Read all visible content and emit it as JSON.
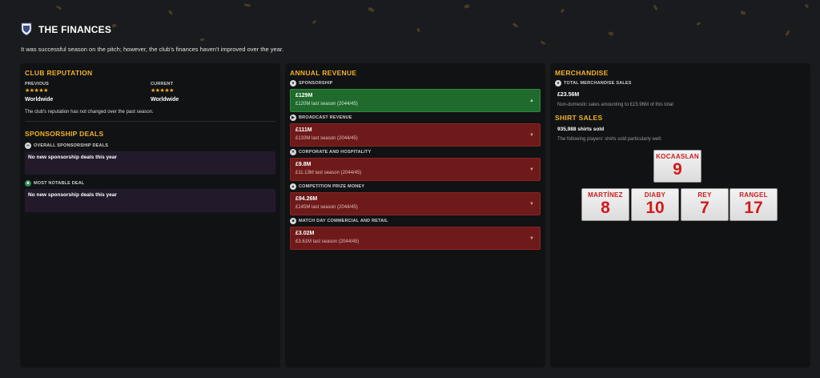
{
  "header": {
    "title": "THE FINANCES",
    "intro": "It was successful season on the pitch; however, the club's finances haven't improved over the year."
  },
  "reputation": {
    "title": "CLUB REPUTATION",
    "previous_label": "PREVIOUS",
    "previous_stars": "★★★★★",
    "previous_value": "Worldwide",
    "current_label": "CURRENT",
    "current_stars": "★★★★★",
    "current_value": "Worldwide",
    "note": "The club's reputation has not changed over the past season."
  },
  "sponsorship": {
    "title": "SPONSORSHIP DEALS",
    "overall_label": "OVERALL SPONSORSHIP DEALS",
    "overall_text": "No new sponsorship deals this year",
    "notable_label": "MOST NOTABLE DEAL",
    "notable_text": "No new sponsorship deals this year"
  },
  "revenue": {
    "title": "ANNUAL REVENUE",
    "items": [
      {
        "label": "SPONSORSHIP",
        "value": "£129M",
        "previous": "£120M last season (2044/45)",
        "trend": "up",
        "arrow": "▲"
      },
      {
        "label": "BROADCAST REVENUE",
        "value": "£111M",
        "previous": "£133M last season (2044/45)",
        "trend": "down",
        "arrow": "▼"
      },
      {
        "label": "CORPORATE AND HOSPITALITY",
        "value": "£9.8M",
        "previous": "£11.13M last season (2044/45)",
        "trend": "down",
        "arrow": "▼"
      },
      {
        "label": "COMPETITION PRIZE MONEY",
        "value": "£94.26M",
        "previous": "£145M last season (2044/45)",
        "trend": "down",
        "arrow": "▼"
      },
      {
        "label": "MATCH DAY COMMERCIAL AND RETAIL",
        "value": "£3.02M",
        "previous": "£3.61M last season (2044/45)",
        "trend": "down",
        "arrow": "▼"
      }
    ]
  },
  "merchandise": {
    "title": "MERCHANDISE",
    "total_label": "TOTAL MERCHANDISE SALES",
    "total_value": "£23.56M",
    "total_note": "Non-domestic sales amounting to £15.96M of this total",
    "shirts_title": "SHIRT SALES",
    "shirts_count": "935,988 shirts sold",
    "shirts_note": "The following players' shirts sold particularly well:",
    "shirts": [
      {
        "name": "KOCAASLAN",
        "number": "9"
      },
      {
        "name": "MARTÍNEZ",
        "number": "8"
      },
      {
        "name": "DIABY",
        "number": "10"
      },
      {
        "name": "REY",
        "number": "7"
      },
      {
        "name": "RANGEL",
        "number": "17"
      }
    ]
  },
  "colors": {
    "accent": "#f2b318",
    "positive": "#1f6a2d",
    "negative": "#6e1a1a",
    "deal_box": "#221a2b",
    "shirt_text": "#d21a1a"
  }
}
